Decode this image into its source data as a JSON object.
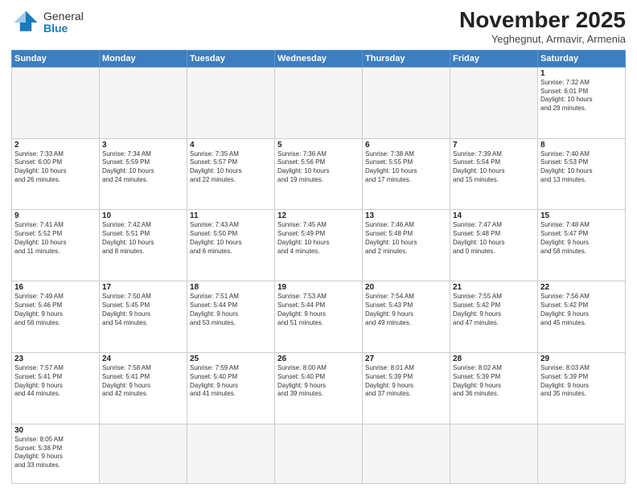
{
  "logo": {
    "general": "General",
    "blue": "Blue"
  },
  "header": {
    "month": "November 2025",
    "location": "Yeghegnut, Armavir, Armenia"
  },
  "weekdays": [
    "Sunday",
    "Monday",
    "Tuesday",
    "Wednesday",
    "Thursday",
    "Friday",
    "Saturday"
  ],
  "days": [
    {
      "num": "",
      "info": "",
      "empty": true
    },
    {
      "num": "",
      "info": "",
      "empty": true
    },
    {
      "num": "",
      "info": "",
      "empty": true
    },
    {
      "num": "",
      "info": "",
      "empty": true
    },
    {
      "num": "",
      "info": "",
      "empty": true
    },
    {
      "num": "",
      "info": "",
      "empty": true
    },
    {
      "num": "1",
      "info": "Sunrise: 7:32 AM\nSunset: 6:01 PM\nDaylight: 10 hours\nand 29 minutes."
    },
    {
      "num": "2",
      "info": "Sunrise: 7:33 AM\nSunset: 6:00 PM\nDaylight: 10 hours\nand 26 minutes."
    },
    {
      "num": "3",
      "info": "Sunrise: 7:34 AM\nSunset: 5:59 PM\nDaylight: 10 hours\nand 24 minutes."
    },
    {
      "num": "4",
      "info": "Sunrise: 7:35 AM\nSunset: 5:57 PM\nDaylight: 10 hours\nand 22 minutes."
    },
    {
      "num": "5",
      "info": "Sunrise: 7:36 AM\nSunset: 5:56 PM\nDaylight: 10 hours\nand 19 minutes."
    },
    {
      "num": "6",
      "info": "Sunrise: 7:38 AM\nSunset: 5:55 PM\nDaylight: 10 hours\nand 17 minutes."
    },
    {
      "num": "7",
      "info": "Sunrise: 7:39 AM\nSunset: 5:54 PM\nDaylight: 10 hours\nand 15 minutes."
    },
    {
      "num": "8",
      "info": "Sunrise: 7:40 AM\nSunset: 5:53 PM\nDaylight: 10 hours\nand 13 minutes."
    },
    {
      "num": "9",
      "info": "Sunrise: 7:41 AM\nSunset: 5:52 PM\nDaylight: 10 hours\nand 11 minutes."
    },
    {
      "num": "10",
      "info": "Sunrise: 7:42 AM\nSunset: 5:51 PM\nDaylight: 10 hours\nand 8 minutes."
    },
    {
      "num": "11",
      "info": "Sunrise: 7:43 AM\nSunset: 5:50 PM\nDaylight: 10 hours\nand 6 minutes."
    },
    {
      "num": "12",
      "info": "Sunrise: 7:45 AM\nSunset: 5:49 PM\nDaylight: 10 hours\nand 4 minutes."
    },
    {
      "num": "13",
      "info": "Sunrise: 7:46 AM\nSunset: 5:48 PM\nDaylight: 10 hours\nand 2 minutes."
    },
    {
      "num": "14",
      "info": "Sunrise: 7:47 AM\nSunset: 5:48 PM\nDaylight: 10 hours\nand 0 minutes."
    },
    {
      "num": "15",
      "info": "Sunrise: 7:48 AM\nSunset: 5:47 PM\nDaylight: 9 hours\nand 58 minutes."
    },
    {
      "num": "16",
      "info": "Sunrise: 7:49 AM\nSunset: 5:46 PM\nDaylight: 9 hours\nand 56 minutes."
    },
    {
      "num": "17",
      "info": "Sunrise: 7:50 AM\nSunset: 5:45 PM\nDaylight: 9 hours\nand 54 minutes."
    },
    {
      "num": "18",
      "info": "Sunrise: 7:51 AM\nSunset: 5:44 PM\nDaylight: 9 hours\nand 53 minutes."
    },
    {
      "num": "19",
      "info": "Sunrise: 7:53 AM\nSunset: 5:44 PM\nDaylight: 9 hours\nand 51 minutes."
    },
    {
      "num": "20",
      "info": "Sunrise: 7:54 AM\nSunset: 5:43 PM\nDaylight: 9 hours\nand 49 minutes."
    },
    {
      "num": "21",
      "info": "Sunrise: 7:55 AM\nSunset: 5:42 PM\nDaylight: 9 hours\nand 47 minutes."
    },
    {
      "num": "22",
      "info": "Sunrise: 7:56 AM\nSunset: 5:42 PM\nDaylight: 9 hours\nand 45 minutes."
    },
    {
      "num": "23",
      "info": "Sunrise: 7:57 AM\nSunset: 5:41 PM\nDaylight: 9 hours\nand 44 minutes."
    },
    {
      "num": "24",
      "info": "Sunrise: 7:58 AM\nSunset: 5:41 PM\nDaylight: 9 hours\nand 42 minutes."
    },
    {
      "num": "25",
      "info": "Sunrise: 7:59 AM\nSunset: 5:40 PM\nDaylight: 9 hours\nand 41 minutes."
    },
    {
      "num": "26",
      "info": "Sunrise: 8:00 AM\nSunset: 5:40 PM\nDaylight: 9 hours\nand 39 minutes."
    },
    {
      "num": "27",
      "info": "Sunrise: 8:01 AM\nSunset: 5:39 PM\nDaylight: 9 hours\nand 37 minutes."
    },
    {
      "num": "28",
      "info": "Sunrise: 8:02 AM\nSunset: 5:39 PM\nDaylight: 9 hours\nand 36 minutes."
    },
    {
      "num": "29",
      "info": "Sunrise: 8:03 AM\nSunset: 5:39 PM\nDaylight: 9 hours\nand 35 minutes."
    },
    {
      "num": "30",
      "info": "Sunrise: 8:05 AM\nSunset: 5:38 PM\nDaylight: 9 hours\nand 33 minutes."
    },
    {
      "num": "",
      "info": "",
      "empty": true
    },
    {
      "num": "",
      "info": "",
      "empty": true
    },
    {
      "num": "",
      "info": "",
      "empty": true
    },
    {
      "num": "",
      "info": "",
      "empty": true
    },
    {
      "num": "",
      "info": "",
      "empty": true
    },
    {
      "num": "",
      "info": "",
      "empty": true
    }
  ]
}
